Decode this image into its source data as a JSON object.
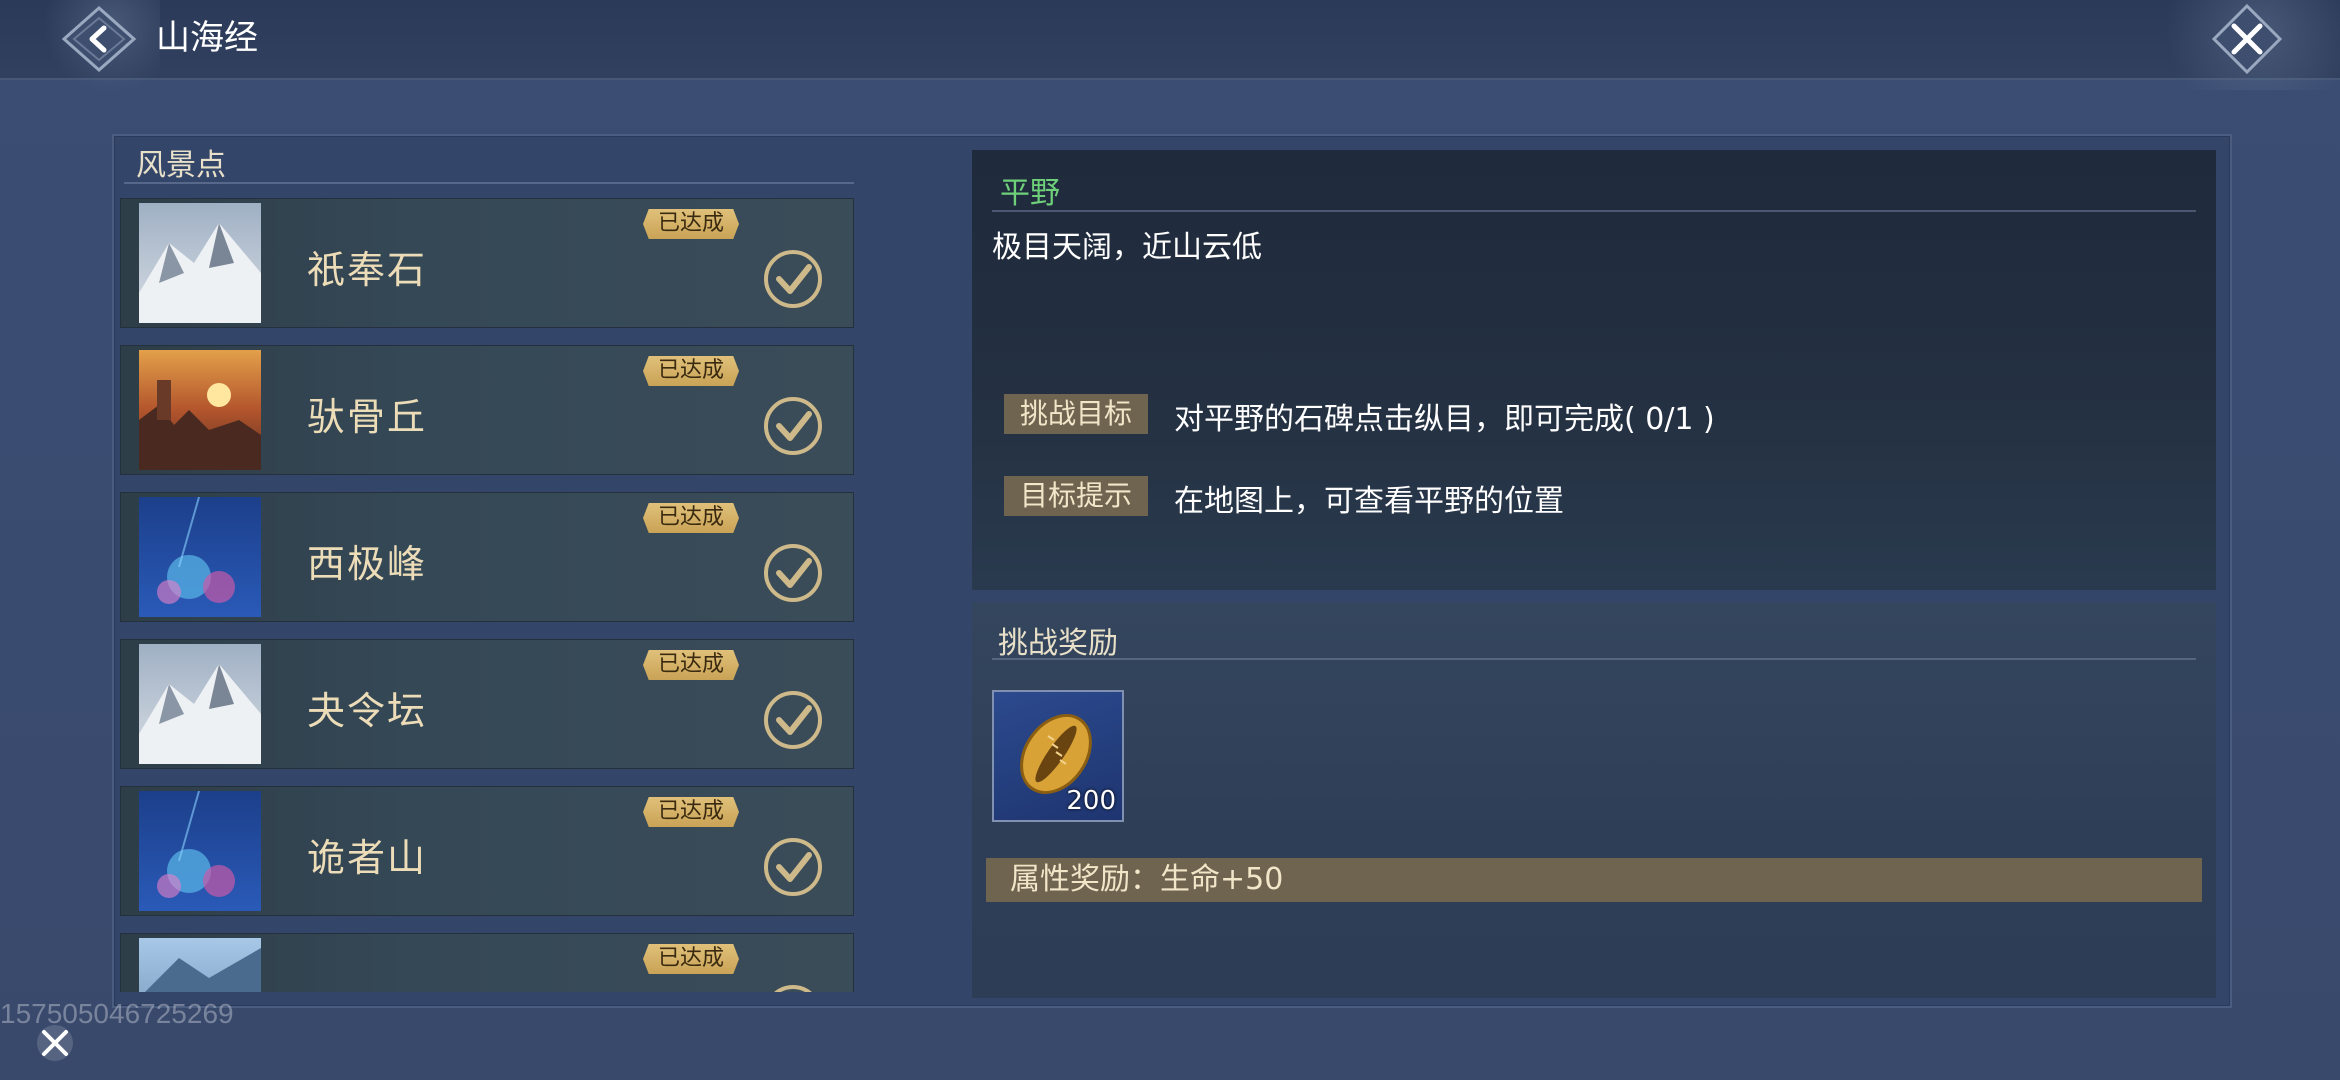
{
  "header": {
    "title": "山海经"
  },
  "scenic": {
    "header": "风景点",
    "badge_label": "已达成",
    "items": [
      {
        "name": "祇奉石",
        "thumb": "snow-mountain"
      },
      {
        "name": "驮骨丘",
        "thumb": "sunset-canyon"
      },
      {
        "name": "西极峰",
        "thumb": "blue-coral"
      },
      {
        "name": "夬令坛",
        "thumb": "snow-mountain"
      },
      {
        "name": "诡者山",
        "thumb": "blue-coral"
      },
      {
        "name": "",
        "thumb": "sky-peak"
      }
    ]
  },
  "detail": {
    "title": "平野",
    "description": "极目天阔，近山云低",
    "goal_label": "挑战目标",
    "goal_text": "对平野的石碑点击纵目，即可完成( 0/1 )",
    "hint_label": "目标提示",
    "hint_text": "在地图上，可查看平野的位置"
  },
  "reward": {
    "title": "挑战奖励",
    "item_count": "200",
    "attribute": "属性奖励：生命+50"
  },
  "watermark": "15750504672526​9",
  "colors": {
    "accent_green": "#6fd07a",
    "badge_gold": "#d6b46a",
    "tag_bg": "#6e6450"
  }
}
